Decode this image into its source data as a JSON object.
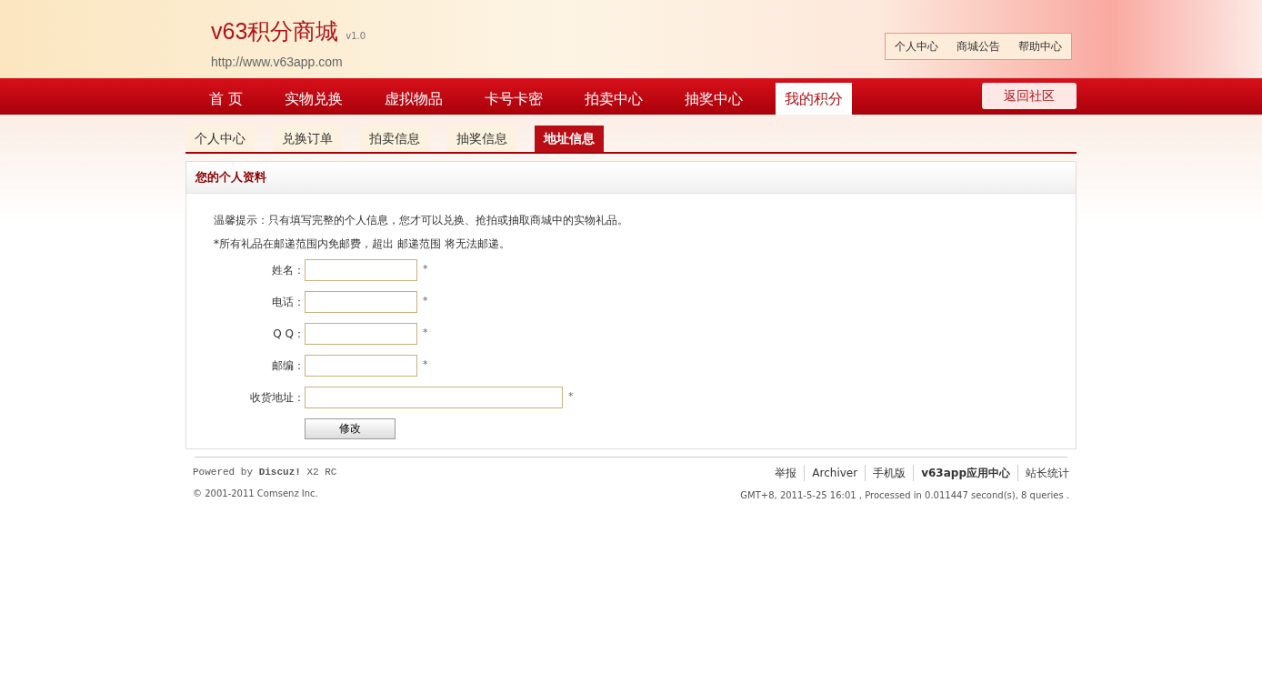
{
  "header": {
    "logo": "v63积分商城",
    "version": "v1.0",
    "url": "http://www.v63app.com",
    "top_links": [
      "个人中心",
      "商城公告",
      "帮助中心"
    ]
  },
  "nav": {
    "items": [
      {
        "label": "首 页",
        "selected": false
      },
      {
        "label": "实物兑换",
        "selected": false
      },
      {
        "label": "虚拟物品",
        "selected": false
      },
      {
        "label": "卡号卡密",
        "selected": false
      },
      {
        "label": "拍卖中心",
        "selected": false
      },
      {
        "label": "抽奖中心",
        "selected": false
      },
      {
        "label": "我的积分",
        "selected": true
      }
    ],
    "back_button": "返回社区"
  },
  "tabs": [
    {
      "label": "个人中心",
      "selected": false
    },
    {
      "label": "兑换订单",
      "selected": false
    },
    {
      "label": "拍卖信息",
      "selected": false
    },
    {
      "label": "抽奖信息",
      "selected": false
    },
    {
      "label": "地址信息",
      "selected": true
    }
  ],
  "panel": {
    "title": "您的个人资料",
    "notes": [
      "温馨提示：只有填写完整的个人信息，您才可以兑换、抢拍或抽取商城中的实物礼品。",
      "*所有礼品在邮递范围内免邮费，超出 邮递范围 将无法邮递。"
    ],
    "fields": [
      {
        "label": "姓名：",
        "required": "*",
        "kind": "short"
      },
      {
        "label": "电话：",
        "required": "*",
        "kind": "short"
      },
      {
        "label": "Q Q：",
        "required": "*",
        "kind": "short"
      },
      {
        "label": "邮编：",
        "required": "*",
        "kind": "short"
      },
      {
        "label": "收货地址：",
        "required": "*",
        "kind": "long"
      }
    ],
    "submit": "修改"
  },
  "footer": {
    "powered": "Powered by **Discuz!** X2 RC",
    "copyright": "© 2001-2011 Comsenz Inc.",
    "links": [
      {
        "label": "举报",
        "bold": false
      },
      {
        "label": "Archiver",
        "bold": false
      },
      {
        "label": "手机版",
        "bold": false
      },
      {
        "label": "v63app应用中心",
        "bold": true
      },
      {
        "label": "站长统计",
        "bold": false
      }
    ],
    "stats": "GMT+8, 2011-5-25 16:01 , Processed in 0.011447 second(s), 8 queries ."
  }
}
